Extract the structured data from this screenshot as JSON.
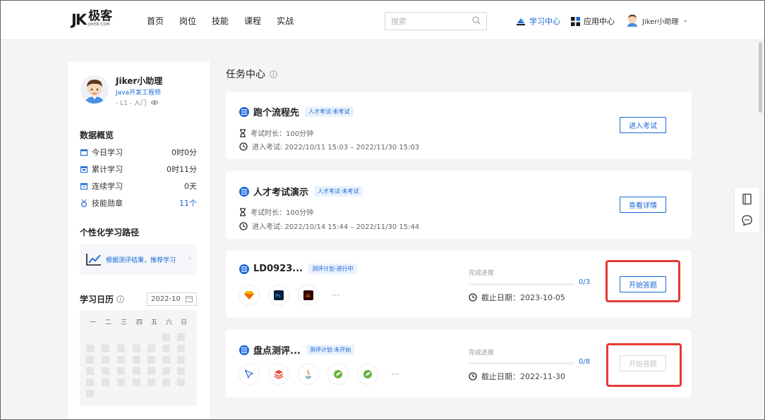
{
  "header": {
    "logo_mark": "JK",
    "logo_cn": "极客",
    "logo_en": "JIKER.COM",
    "nav": [
      "首页",
      "岗位",
      "技能",
      "课程",
      "实战"
    ],
    "search_placeholder": "搜索",
    "study_center": "学习中心",
    "app_center": "应用中心",
    "user_name": "Jiker小助理"
  },
  "profile": {
    "name": "Jiker小助理",
    "role": "Java开发工程师",
    "level": "- L1 - 入门"
  },
  "overview": {
    "title": "数据概览",
    "stats": [
      {
        "label": "今日学习",
        "value": "0时0分"
      },
      {
        "label": "累计学习",
        "value": "0时11分"
      },
      {
        "label": "连续学习",
        "value": "0天"
      },
      {
        "label": "技能勋章",
        "value": "11个"
      }
    ]
  },
  "path": {
    "title": "个性化学习路径",
    "link": "根据测评结果，推荐学习"
  },
  "calendar": {
    "title": "学习日历",
    "month": "2022-10",
    "weekdays": [
      "一",
      "二",
      "三",
      "四",
      "五",
      "六",
      "日"
    ]
  },
  "main": {
    "title": "任务中心"
  },
  "tasks": [
    {
      "title": "跑个流程先",
      "tag": "人才考试·未考试",
      "duration": "考试时长：100分钟",
      "window": "进入考试: 2022/10/11 15:03 – 2022/11/30 15:03",
      "button": "进入考试"
    },
    {
      "title": "人才考试演示",
      "tag": "人才考试·未考试",
      "duration": "考试时长：100分钟",
      "window": "进入考试: 2022/10/14 15:44 – 2022/11/30 15:44",
      "button": "查看详情"
    },
    {
      "title": "LD0923...",
      "tag": "测评计划·进行中",
      "progress_label": "完成进度",
      "progress": "0/3",
      "progress_fraction": 0,
      "deadline": "截止日期：2023-10-05",
      "button": "开始答题",
      "icons": [
        "sketch-icon",
        "photoshop-icon",
        "illustrator-icon"
      ]
    },
    {
      "title": "盘点测评...",
      "tag": "测评计划·未开始",
      "progress_label": "完成进度",
      "progress": "0/8",
      "progress_fraction": 0,
      "deadline": "截止日期：2022-11-30",
      "button": "开始答题",
      "icons": [
        "pen-tool-icon",
        "stack-icon",
        "java-icon",
        "spring-icon",
        "spring-boot-icon"
      ]
    }
  ],
  "colors": {
    "accent": "#1867d6",
    "highlight": "#e53935",
    "background": "#f4f4f4"
  }
}
